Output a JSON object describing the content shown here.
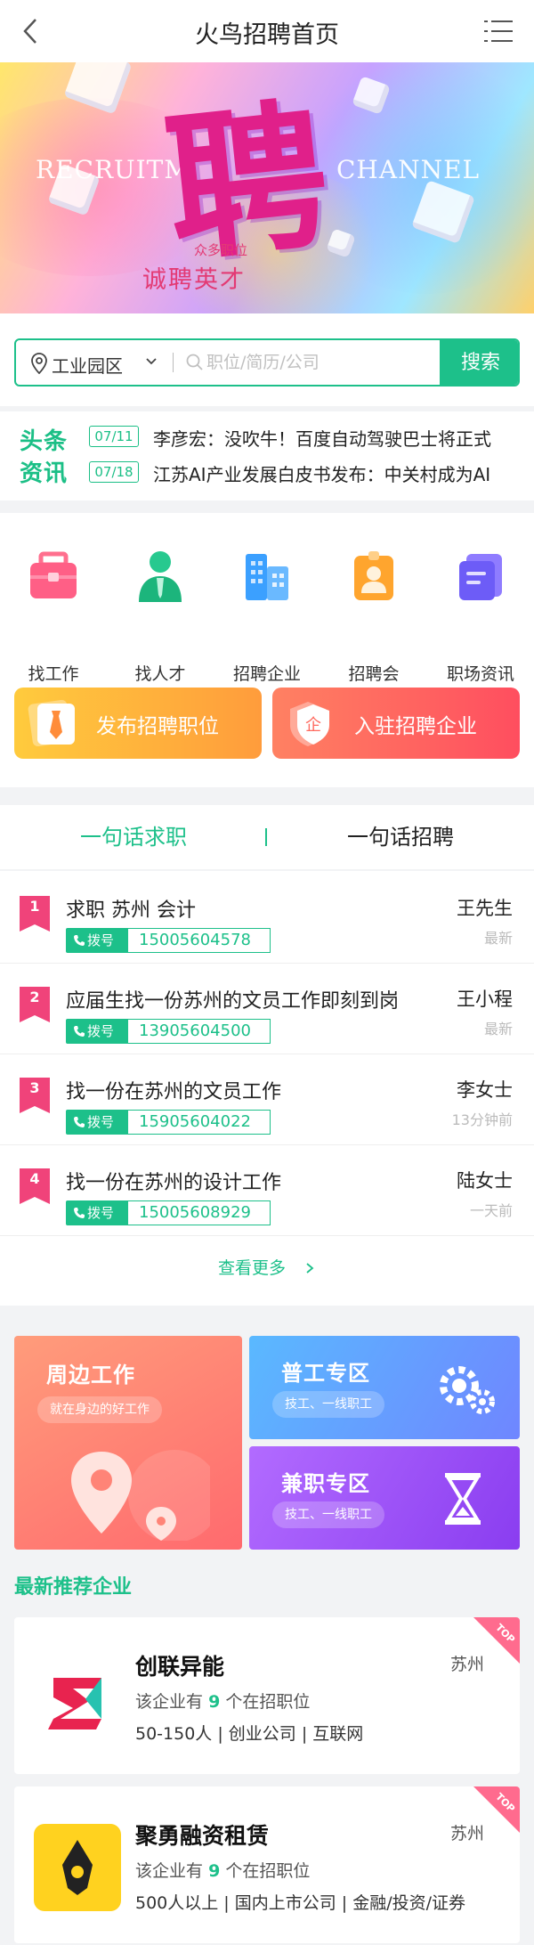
{
  "header": {
    "title": "火鸟招聘首页",
    "back_icon": "chevron-left-icon",
    "menu_icon": "list-menu-icon"
  },
  "banner": {
    "en_left": "RECRUITM",
    "en_right": "CHANNEL",
    "big_char": "聘",
    "sub_small": "众多职位",
    "sub_big": "诚聘英才"
  },
  "search": {
    "area": "工业园区",
    "placeholder": "职位/简历/公司",
    "button": "搜索"
  },
  "news": {
    "logo_line1": "头条",
    "logo_line2": "资讯",
    "items": [
      {
        "date": "07/11",
        "text": "李彦宏：没吹牛！百度自动驾驶巴士将正式"
      },
      {
        "date": "07/18",
        "text": "江苏AI产业发展白皮书发布：中关村成为AI"
      }
    ]
  },
  "nav": {
    "items": [
      {
        "label": "找工作",
        "icon": "briefcase-icon"
      },
      {
        "label": "找人才",
        "icon": "person-icon"
      },
      {
        "label": "招聘企业",
        "icon": "buildings-icon"
      },
      {
        "label": "招聘会",
        "icon": "id-card-icon"
      },
      {
        "label": "职场资讯",
        "icon": "document-icon"
      }
    ],
    "cta_post": "发布招聘职位",
    "cta_join": "入驻招聘企业"
  },
  "tabs": {
    "tab1": "一句话求职",
    "tab2": "一句话招聘"
  },
  "jobs": {
    "dial_label": "拨号",
    "items": [
      {
        "rank": "1",
        "title": "求职 苏州 会计",
        "phone": "15005604578",
        "name": "王先生",
        "time": "最新"
      },
      {
        "rank": "2",
        "title": "应届生找一份苏州的文员工作即刻到岗",
        "phone": "13905604500",
        "name": "王小程",
        "time": "最新"
      },
      {
        "rank": "3",
        "title": "找一份在苏州的文员工作",
        "phone": "15905604022",
        "name": "李女士",
        "time": "13分钟前"
      },
      {
        "rank": "4",
        "title": "找一份在苏州的设计工作",
        "phone": "15005608929",
        "name": "陆女士",
        "time": "一天前"
      }
    ],
    "more": "查看更多"
  },
  "zones": {
    "nearby": {
      "title": "周边工作",
      "sub": "就在身边的好工作"
    },
    "general": {
      "title": "普工专区",
      "sub": "技工、一线职工"
    },
    "parttime": {
      "title": "兼职专区",
      "sub": "技工、一线职工"
    }
  },
  "companies": {
    "section_title": "最新推荐企业",
    "badge": "TOP",
    "items": [
      {
        "name": "创联异能",
        "city": "苏州",
        "desc_pre": "该企业有",
        "count": "9",
        "desc_post": "个在招职位",
        "tags": "50-150人 | 创业公司 | 互联网"
      },
      {
        "name": "聚勇融资租赁",
        "city": "苏州",
        "desc_pre": "该企业有",
        "count": "9",
        "desc_post": "个在招职位",
        "tags": "500人以上 | 国内上市公司 | 金融/投资/证券"
      }
    ]
  },
  "colors": {
    "accent": "#1dc08a",
    "orange": "#ffa43b",
    "red": "#ff5a5f",
    "rank_pink": "#f0437a"
  }
}
